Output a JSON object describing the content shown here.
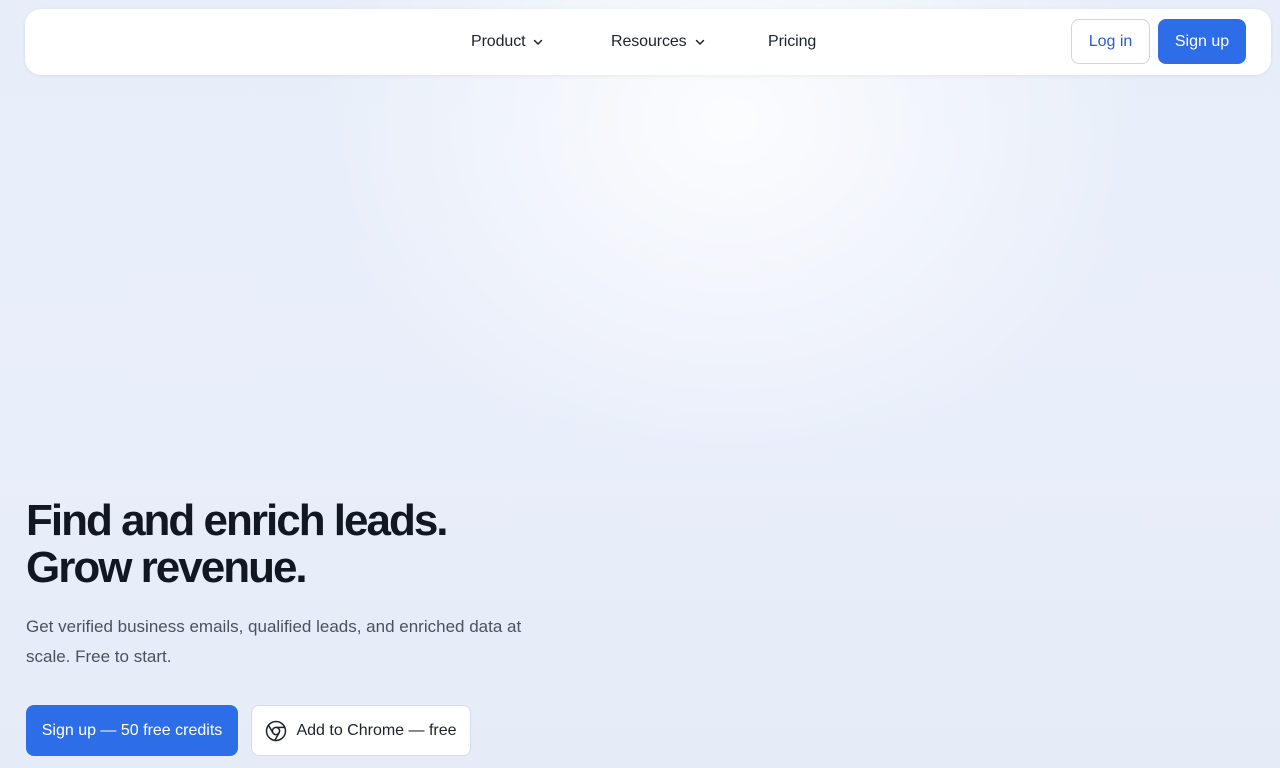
{
  "nav": {
    "product": "Product",
    "resources": "Resources",
    "pricing": "Pricing",
    "login": "Log in",
    "signup": "Sign up"
  },
  "hero": {
    "title_line1": "Find and enrich leads.",
    "title_line2": "Grow revenue.",
    "subtitle": "Get verified business emails, qualified leads, and enriched data at scale. Free to start.",
    "cta_primary": "Sign up — 50 free credits",
    "cta_secondary": "Add to Chrome — free"
  },
  "icons": {
    "dropdown": "chevron-down-icon",
    "chrome": "chrome-icon"
  },
  "colors": {
    "accent": "#2d6ee8",
    "login_text": "#2a5bd7",
    "heading": "#121722"
  }
}
